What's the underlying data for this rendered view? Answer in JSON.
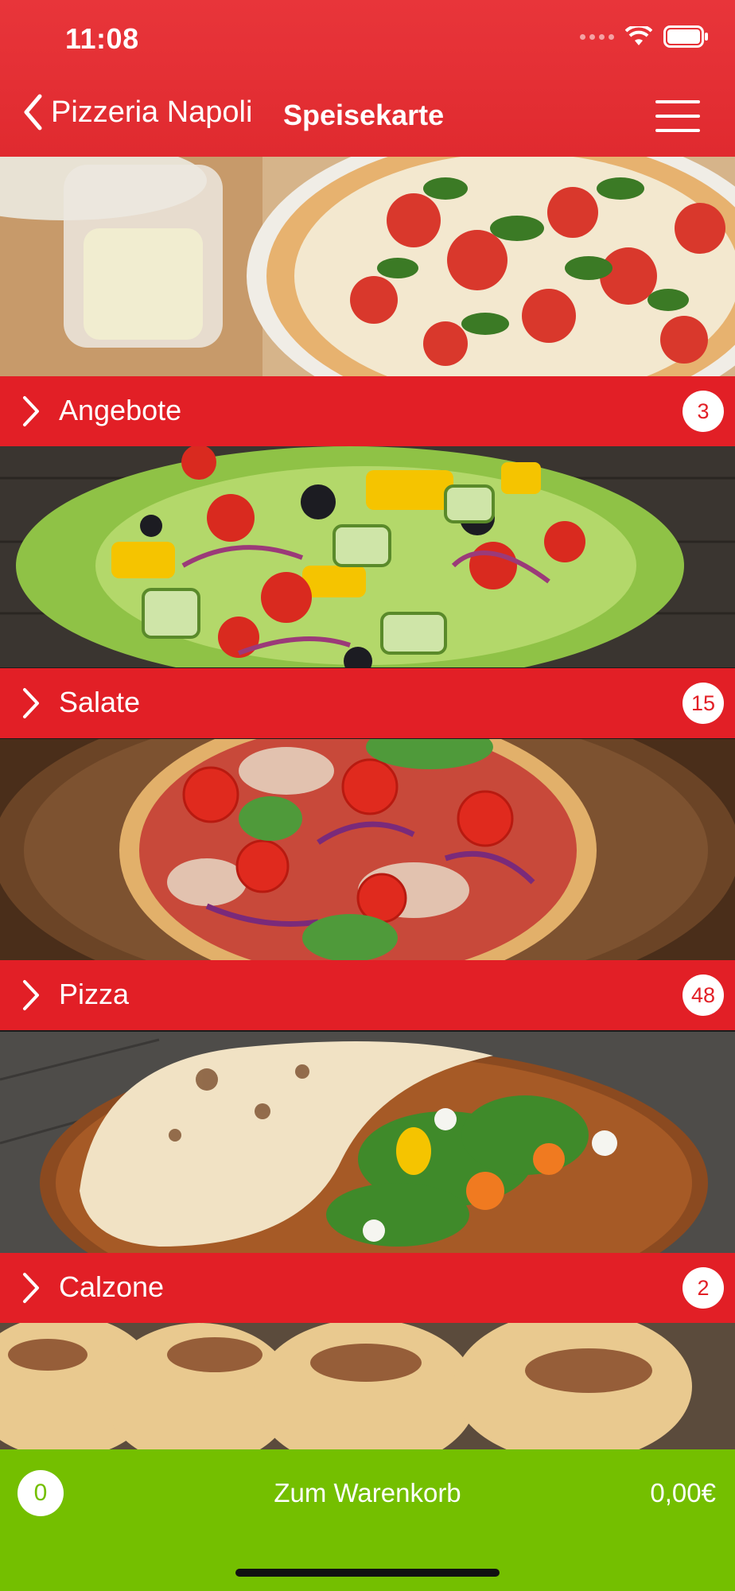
{
  "status_bar": {
    "time": "11:08"
  },
  "nav": {
    "back_label": "Pizzeria Napoli",
    "title": "Speisekarte"
  },
  "categories": [
    {
      "label": "Angebote",
      "count": "3"
    },
    {
      "label": "Salate",
      "count": "15"
    },
    {
      "label": "Pizza",
      "count": "48"
    },
    {
      "label": "Calzone",
      "count": "2"
    }
  ],
  "cart": {
    "count": "0",
    "label": "Zum Warenkorb",
    "total": "0,00€"
  },
  "colors": {
    "header": "#e8353a",
    "bar": "#e21f26",
    "cart": "#74bf00"
  }
}
